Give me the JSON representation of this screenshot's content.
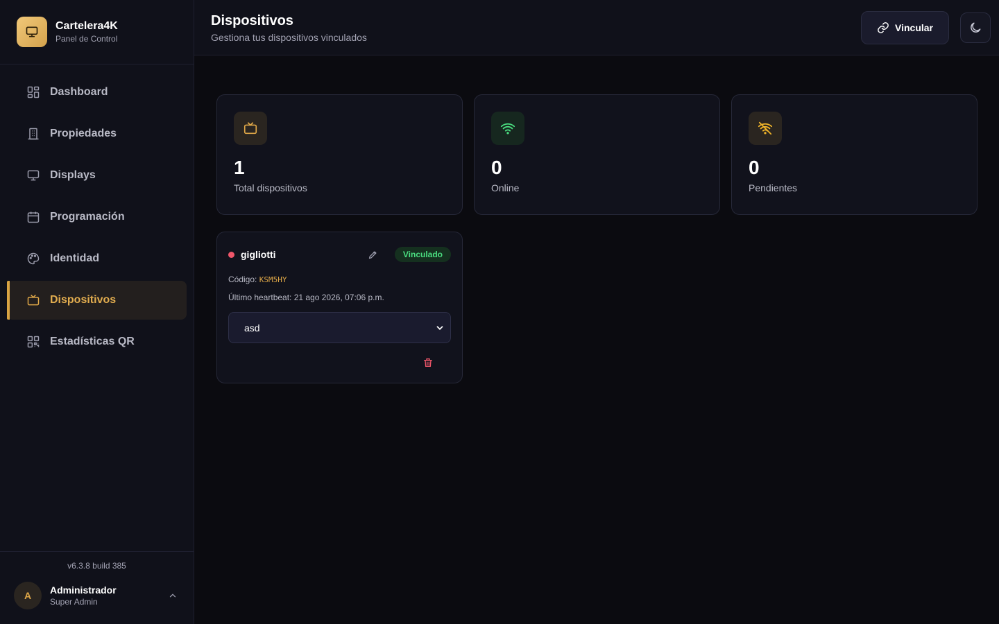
{
  "brand": {
    "title": "Cartelera4K",
    "subtitle": "Panel de Control"
  },
  "sidebar": {
    "items": [
      {
        "label": "Dashboard",
        "icon": "dashboard-grid-icon",
        "active": false
      },
      {
        "label": "Propiedades",
        "icon": "building-icon",
        "active": false
      },
      {
        "label": "Displays",
        "icon": "monitor-icon",
        "active": false
      },
      {
        "label": "Programación",
        "icon": "calendar-icon",
        "active": false
      },
      {
        "label": "Identidad",
        "icon": "palette-icon",
        "active": false
      },
      {
        "label": "Dispositivos",
        "icon": "tv-icon",
        "active": true
      },
      {
        "label": "Estadísticas QR",
        "icon": "qr-code-icon",
        "active": false
      }
    ],
    "version": "v6.3.8 build 385",
    "user": {
      "initial": "A",
      "name": "Administrador",
      "role": "Super Admin"
    }
  },
  "header": {
    "title": "Dispositivos",
    "subtitle": "Gestiona tus dispositivos vinculados",
    "link_button": "Vincular"
  },
  "stats": [
    {
      "value": "1",
      "label": "Total dispositivos",
      "icon": "tv-icon"
    },
    {
      "value": "0",
      "label": "Online",
      "icon": "wifi-icon"
    },
    {
      "value": "0",
      "label": "Pendientes",
      "icon": "wifi-off-icon"
    }
  ],
  "device": {
    "name": "gigliotti",
    "status": "offline",
    "badge": "Vinculado",
    "code_label": "Código:",
    "code": "KSM5HY",
    "heartbeat": "Último heartbeat: 21 ago 2026, 07:06 p.m.",
    "selected_display": "asd"
  },
  "colors": {
    "accent": "#e0a848",
    "online": "#4ade80",
    "offline": "#f0566a",
    "background": "#0b0b10",
    "panel": "#10111a"
  }
}
